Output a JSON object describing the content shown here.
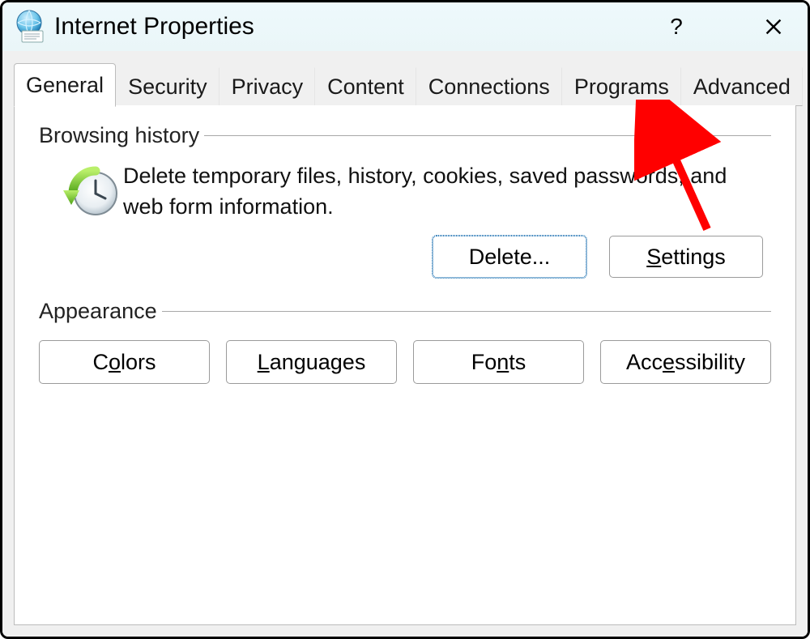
{
  "window": {
    "title": "Internet Properties"
  },
  "titlebar": {
    "help": "?",
    "close": "✕"
  },
  "tabs": [
    {
      "label": "General",
      "active": true
    },
    {
      "label": "Security",
      "active": false
    },
    {
      "label": "Privacy",
      "active": false
    },
    {
      "label": "Content",
      "active": false
    },
    {
      "label": "Connections",
      "active": false
    },
    {
      "label": "Programs",
      "active": false
    },
    {
      "label": "Advanced",
      "active": false
    }
  ],
  "groups": {
    "browsing_history": {
      "label": "Browsing history",
      "description": "Delete temporary files, history, cookies, saved passwords, and web form information.",
      "buttons": {
        "delete": "Delete...",
        "settings": "Settings"
      }
    },
    "appearance": {
      "label": "Appearance",
      "buttons": {
        "colors": "Colors",
        "languages": "Languages",
        "fonts": "Fonts",
        "accessibility": "Accessibility"
      }
    }
  },
  "annotation": {
    "arrow_color": "#ff0000",
    "target_tab": "Advanced"
  }
}
